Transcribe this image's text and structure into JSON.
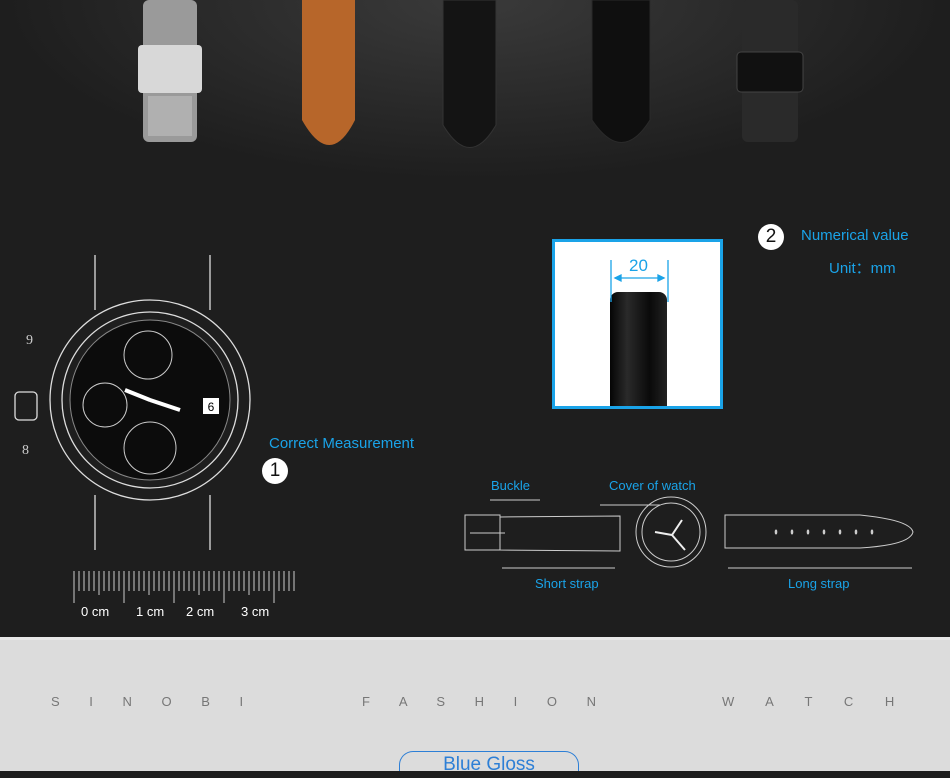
{
  "measurement": {
    "step1_number": "1",
    "step1_label": "Correct Measurement",
    "step2_number": "2",
    "step2_label": "Numerical value",
    "unit_label": "Unit：mm",
    "width_value": "20"
  },
  "ruler": {
    "ticks": [
      "0 cm",
      "1 cm",
      "2 cm",
      "3 cm"
    ]
  },
  "dial_numbers": {
    "nine": "9",
    "eight": "8",
    "date": "6"
  },
  "diagram": {
    "buckle": "Buckle",
    "cover": "Cover of watch",
    "short_strap": "Short strap",
    "long_strap": "Long strap"
  },
  "tagline": [
    "S I N O B I",
    "F A S H I O N",
    "W A T C H"
  ],
  "color_button": "Blue Gloss",
  "colors": {
    "accent": "#1aa3e8",
    "button": "#2d7fd6"
  }
}
